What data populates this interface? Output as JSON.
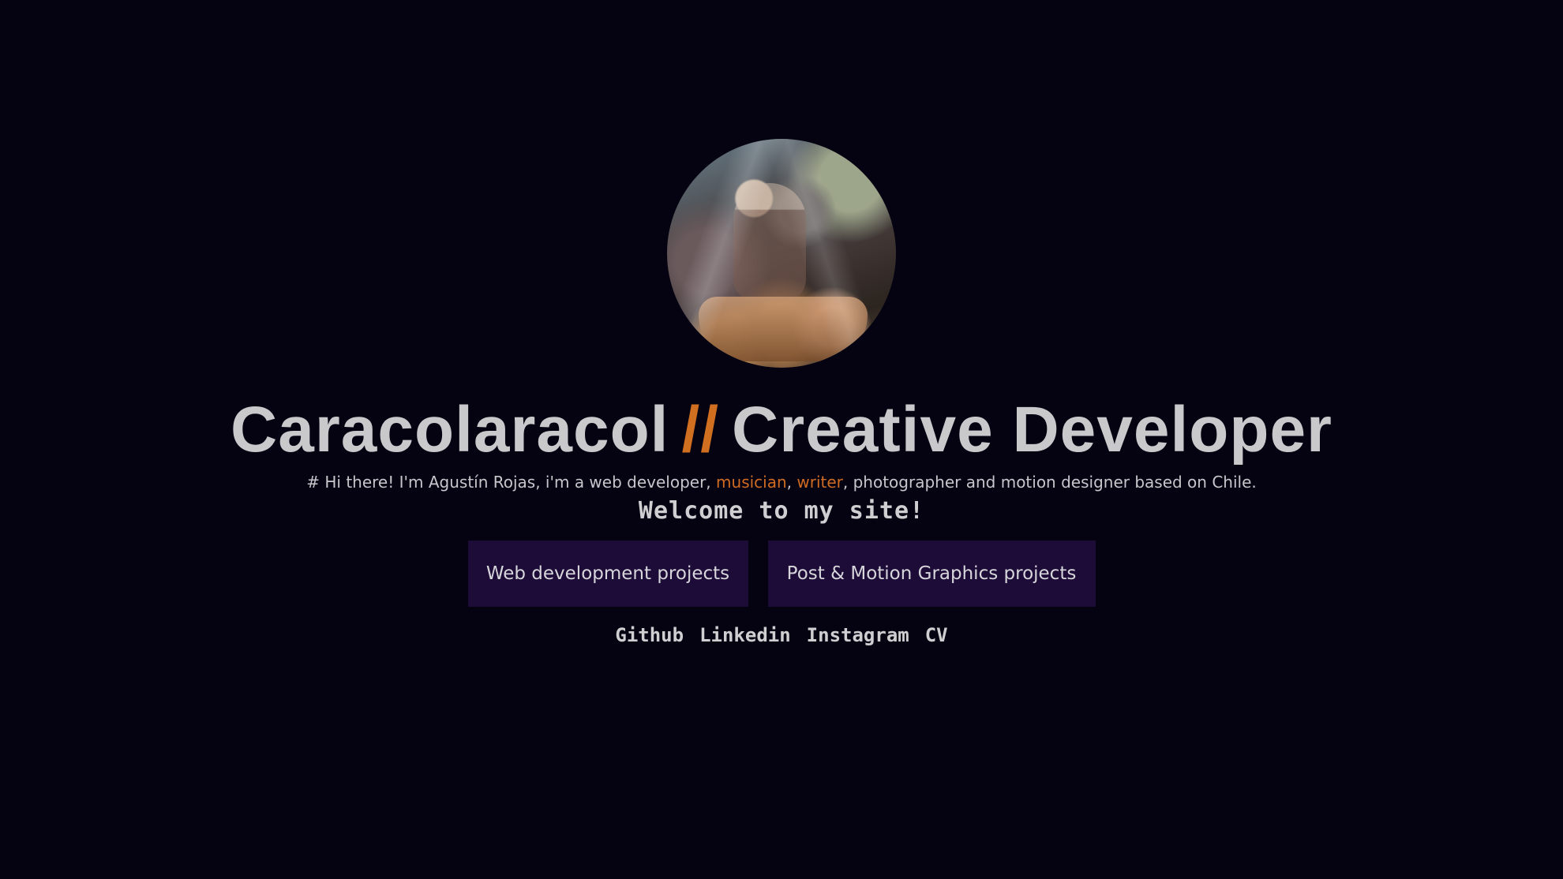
{
  "profile": {
    "avatar_alt": "Profile photo"
  },
  "hero": {
    "title_part1": "Caracolaracol",
    "separator": "//",
    "title_part2": "Creative Developer",
    "intro_prefix": "# Hi there! I'm Agustín Rojas, i'm a web developer, ",
    "intro_musician": "musician",
    "intro_comma": ", ",
    "intro_writer": "writer",
    "intro_suffix": ", photographer and motion designer based on Chile.",
    "welcome": "Welcome to my site!"
  },
  "buttons": {
    "web_projects": "Web development projects",
    "motion_projects": "Post & Motion Graphics projects"
  },
  "links": {
    "github": "Github",
    "linkedin": "Linkedin",
    "instagram": "Instagram",
    "cv": "CV"
  },
  "colors": {
    "background": "#050312",
    "accent": "#D06F1F",
    "button_bg": "#1D0B38",
    "text": "#CFCFD2"
  }
}
